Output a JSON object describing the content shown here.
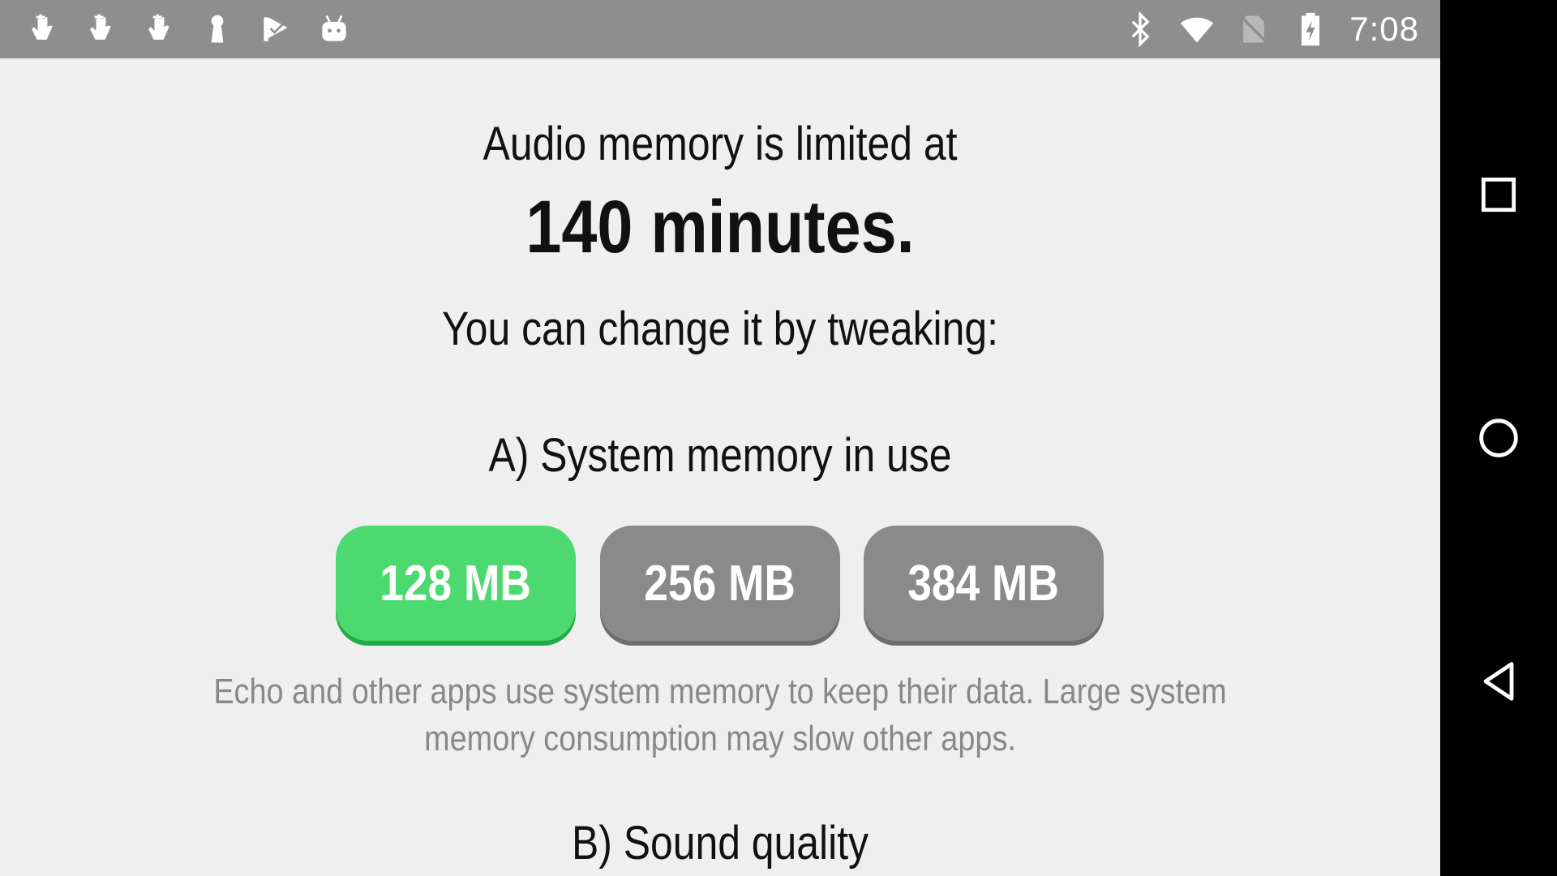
{
  "status_bar": {
    "left_icons": [
      "hand-pointer-icon",
      "hand-pointer-icon",
      "hand-pointer-icon",
      "keyhole-icon",
      "check-flag-icon",
      "android-head-icon"
    ],
    "right_icons": [
      "bluetooth-icon",
      "wifi-icon",
      "no-sim-icon",
      "battery-charging-icon"
    ],
    "time": "7:08"
  },
  "content": {
    "intro": "Audio memory is limited at",
    "limit": "140 minutes.",
    "tweak_prompt": "You can change it by tweaking:",
    "section_a_title": "A) System memory in use",
    "memory_options": [
      {
        "label": "128 MB",
        "selected": true
      },
      {
        "label": "256 MB",
        "selected": false
      },
      {
        "label": "384 MB",
        "selected": false
      }
    ],
    "memory_description": "Echo and other apps use system memory to keep their data. Large system memory consumption may slow other apps.",
    "section_b_title": "B) Sound quality"
  },
  "nav_bar": {
    "buttons": [
      "recents-icon",
      "home-icon",
      "back-icon"
    ]
  },
  "colors": {
    "status_bar": "#8e8e8e",
    "background": "#efefef",
    "selected_button": "#4cd96f",
    "unselected_button": "#8a8a8a",
    "description_text": "#888888"
  }
}
